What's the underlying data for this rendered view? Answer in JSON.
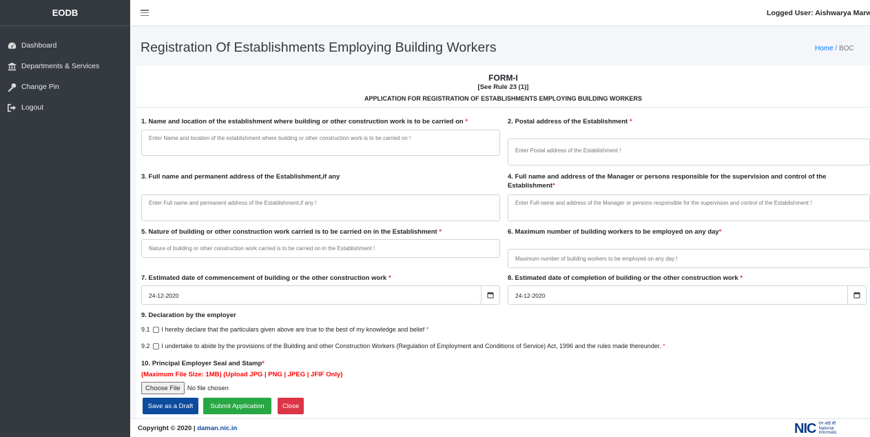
{
  "sidebar": {
    "brand": "EODB",
    "items": [
      {
        "label": "Dashboard",
        "icon": "dashboard-icon"
      },
      {
        "label": "Departments & Services",
        "icon": "bank-icon"
      },
      {
        "label": "Change Pin",
        "icon": "key-icon"
      },
      {
        "label": "Logout",
        "icon": "logout-icon"
      }
    ]
  },
  "topbar": {
    "logged_user": "Logged User: Aishwarya Marwa"
  },
  "header": {
    "title": "Registration Of Establishments Employing Building Workers",
    "breadcrumb_home": "Home",
    "breadcrumb_sep": " / ",
    "breadcrumb_current": "BOC"
  },
  "form": {
    "title": "FORM-I",
    "rule": "[See Rule 23 (1)]",
    "subtitle": "APPLICATION FOR REGISTRATION OF ESTABLISHMENTS EMPLOYING BUILDING WORKERS",
    "q1": {
      "label": "1. Name and location of the establishment where building or other construction work is to be carried on",
      "placeholder": "Enter Name and location of the establishment where building or other construction work is to be carried on !"
    },
    "q2": {
      "label": "2. Postal address of the Establishment",
      "placeholder": "Enter Postal address of the Establishment !"
    },
    "q3": {
      "label": "3. Full name and permanent address of the Establishment,if any",
      "placeholder": "Enter Full name and permanent address of the Establishment,if any !"
    },
    "q4": {
      "label": "4. Full name and address of the Manager or persons responsible for the supervision and control of the Establishment",
      "placeholder": "Enter Full name and address of the Manager or persons responsible for the supervision and control of the Establishment !"
    },
    "q5": {
      "label": "5. Nature of building or other construction work carried is to be carried on in the Establishment",
      "placeholder": "Nature of building or other construction work carried is to be carried on in the Establishment !"
    },
    "q6": {
      "label": "6. Maximum number of building workers to be employed on any day",
      "placeholder": "Maximum number of building workers to be employed on any day !"
    },
    "q7": {
      "label": "7. Estimated date of commencement of building or the other construction work",
      "value": "24-12-2020"
    },
    "q8": {
      "label": "8. Estimated date of completion of building or the other construction work",
      "value": "24-12-2020"
    },
    "q9": {
      "label": "9. Declaration by the employer",
      "d1_num": "9.1",
      "d1_text": "I hereby declare that the particulars given above are true to the best of my knowledge and belief",
      "d2_num": "9.2",
      "d2_text": "I undertake to abide by the provisions of the Building and other Construction Workers (Regulation of Employment and Conditions of Service) Act, 1996 and the rules made thereunder."
    },
    "q10": {
      "label": "10. Principal Employer Seal and Stamp",
      "warning": "(Maximum File Size: 1MB)  (Upload JPG | PNG | JPEG | JFIF Only)",
      "choose_file": "Choose File",
      "no_file": "No file chosen"
    },
    "required_mark": "*"
  },
  "buttons": {
    "draft": "Save as a Draft",
    "submit": "Submit Application",
    "close": "Close"
  },
  "footer": {
    "copyright": "Copyright © 2020 | ",
    "link": "daman.nic.in",
    "logo_mark": "NIC",
    "logo_hindi": "एन आई सी",
    "logo_line1": "National",
    "logo_line2": "Informatic"
  },
  "colors": {
    "sidebar": "#343a40",
    "primary": "#0d4b9e",
    "success": "#28a745",
    "danger": "#dc3545",
    "link": "#007bff"
  }
}
